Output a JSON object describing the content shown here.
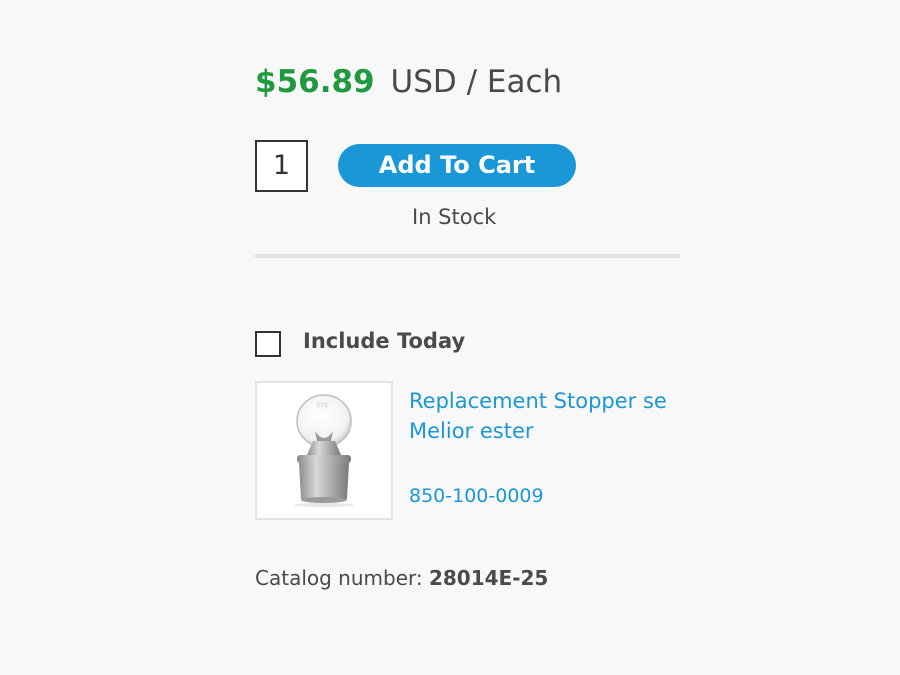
{
  "price": {
    "amount": "$56.89",
    "unit": "USD / Each"
  },
  "purchase": {
    "quantity": "1",
    "add_to_cart_label": "Add To Cart",
    "stock_status": "In Stock"
  },
  "accessory": {
    "include_label": "Include Today",
    "checked": false,
    "product_name": "Replacement Stopper se Melior ester",
    "product_code": "850-100-0009",
    "image_icon": "glass-stopper-icon"
  },
  "catalog": {
    "label": "Catalog number:",
    "value": "28014E-25"
  },
  "colors": {
    "price": "#1f9a3e",
    "accent": "#1a97d6",
    "text": "#4a4a4a",
    "background": "#f8f8f8"
  }
}
